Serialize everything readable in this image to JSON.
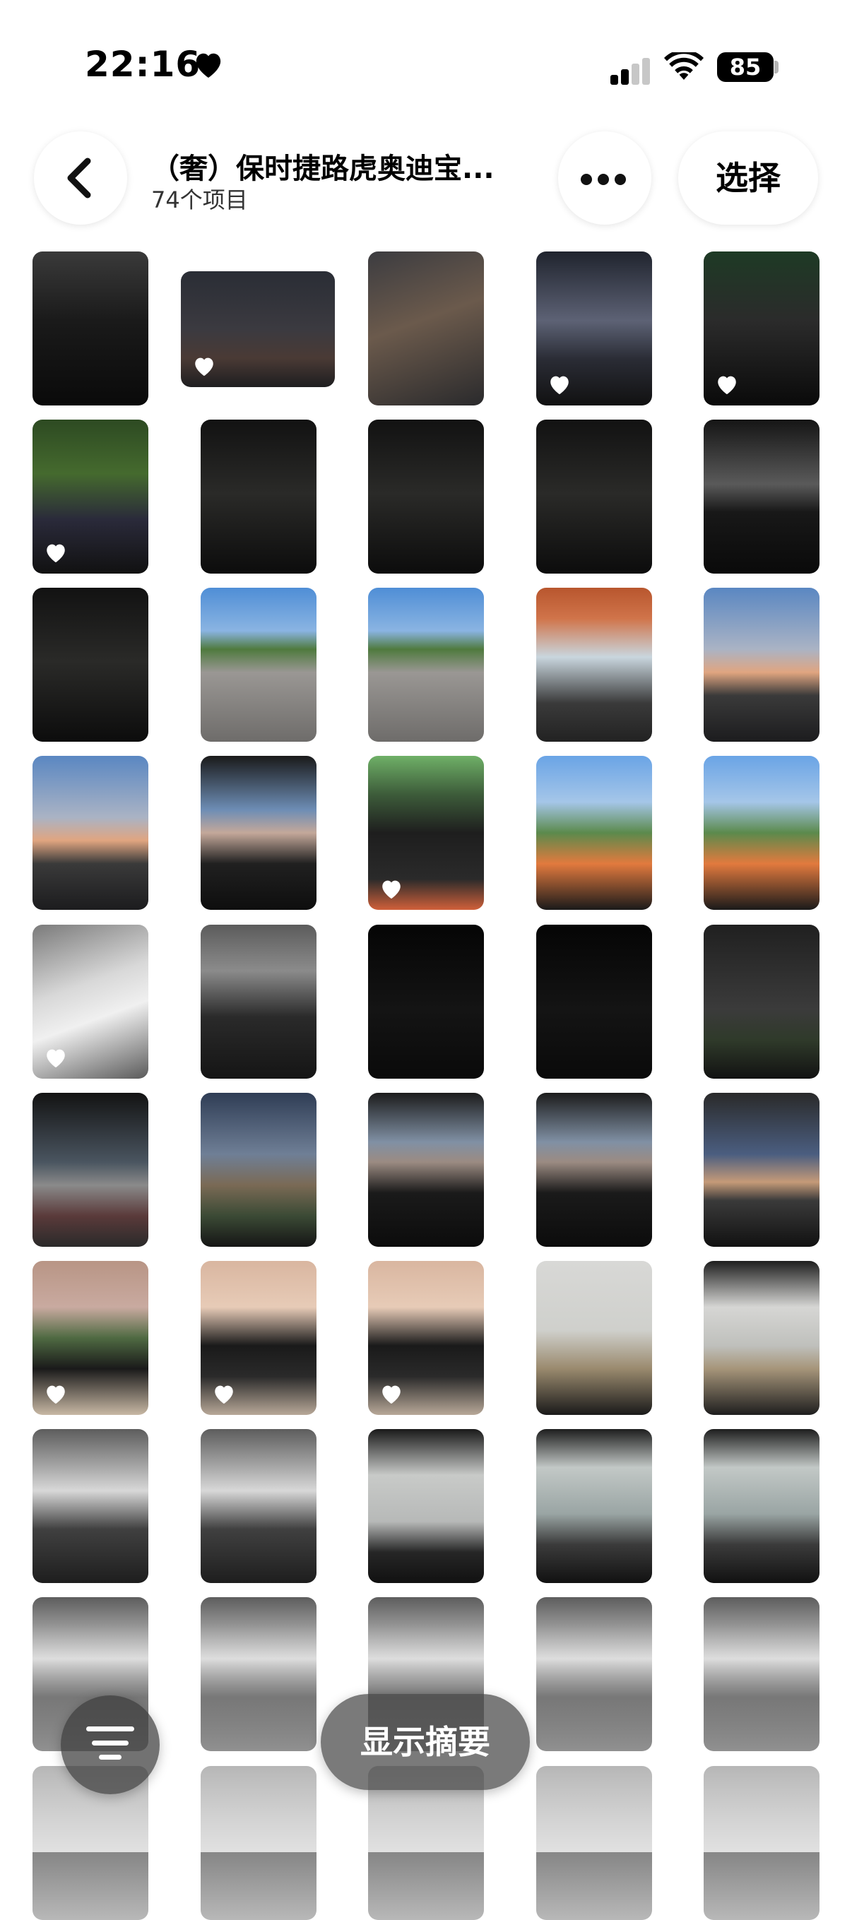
{
  "status_bar": {
    "time": "22:16",
    "battery": "85"
  },
  "header": {
    "album_title": "（奢）保时捷路虎奥迪宝...",
    "item_count": "74个项目",
    "select_label": "选择"
  },
  "bottom_bar": {
    "summary_label": "显示摘要"
  },
  "colors": {
    "background": "#ffffff",
    "favorite_heart": "#ffffff",
    "overlay_button": "#464646"
  },
  "icons": [
    "heart-icon",
    "cellular-signal-icon",
    "wifi-icon",
    "battery-icon",
    "chevron-left-icon",
    "more-icon",
    "filter-icon"
  ],
  "photos": [
    {
      "desc": "car-interior-night",
      "fav": false
    },
    {
      "desc": "highway-toll-night",
      "fav": true
    },
    {
      "desc": "coffee-cup-car",
      "fav": false
    },
    {
      "desc": "bridge-night",
      "fav": true
    },
    {
      "desc": "green-lights-night",
      "fav": true
    },
    {
      "desc": "tree-streetlight-night",
      "fav": true
    },
    {
      "desc": "dark-car-interior",
      "fav": false
    },
    {
      "desc": "dark-car-interior",
      "fav": false
    },
    {
      "desc": "dark-car-interior",
      "fav": false
    },
    {
      "desc": "dark-car-interior-lights",
      "fav": false
    },
    {
      "desc": "dark-car-interior",
      "fav": false
    },
    {
      "desc": "porsche-macan-parking",
      "fav": false
    },
    {
      "desc": "porsche-macan-parking",
      "fav": false
    },
    {
      "desc": "orange-interior-van",
      "fav": false
    },
    {
      "desc": "sunset-road",
      "fav": false
    },
    {
      "desc": "sunset-road",
      "fav": false
    },
    {
      "desc": "dusk-road-window",
      "fav": false
    },
    {
      "desc": "audi-steering-wheel",
      "fav": true
    },
    {
      "desc": "orange-box-dashboard",
      "fav": false
    },
    {
      "desc": "orange-box-dashboard",
      "fav": false
    },
    {
      "desc": "white-g-class-garage",
      "fav": true
    },
    {
      "desc": "car-interior-garage",
      "fav": false
    },
    {
      "desc": "dark-night",
      "fav": false
    },
    {
      "desc": "dark-night",
      "fav": false
    },
    {
      "desc": "street-pole-night",
      "fav": false
    },
    {
      "desc": "night-building",
      "fav": false
    },
    {
      "desc": "dusk-building",
      "fav": false
    },
    {
      "desc": "car-interior-dusk",
      "fav": false
    },
    {
      "desc": "car-interior-dusk",
      "fav": false
    },
    {
      "desc": "sunroof-dusk",
      "fav": false
    },
    {
      "desc": "maybach-building",
      "fav": true
    },
    {
      "desc": "maybach-dusk",
      "fav": true
    },
    {
      "desc": "maybach-dusk",
      "fav": true
    },
    {
      "desc": "grey-sky-road",
      "fav": false
    },
    {
      "desc": "grey-sky-window",
      "fav": false
    },
    {
      "desc": "chauffeur-interior",
      "fav": false
    },
    {
      "desc": "chauffeur-interior",
      "fav": false
    },
    {
      "desc": "grey-city-window",
      "fav": false
    },
    {
      "desc": "sea-window",
      "fav": false
    },
    {
      "desc": "sea-window",
      "fav": false
    },
    {
      "desc": "chauffeur-interior",
      "fav": false
    },
    {
      "desc": "chauffeur-interior",
      "fav": false
    },
    {
      "desc": "chauffeur-interior",
      "fav": false
    },
    {
      "desc": "chauffeur-interior",
      "fav": false
    },
    {
      "desc": "chauffeur-interior",
      "fav": false
    },
    {
      "desc": "partial",
      "fav": false
    },
    {
      "desc": "partial",
      "fav": false
    },
    {
      "desc": "partial",
      "fav": false
    },
    {
      "desc": "partial",
      "fav": false
    },
    {
      "desc": "partial",
      "fav": false
    }
  ]
}
